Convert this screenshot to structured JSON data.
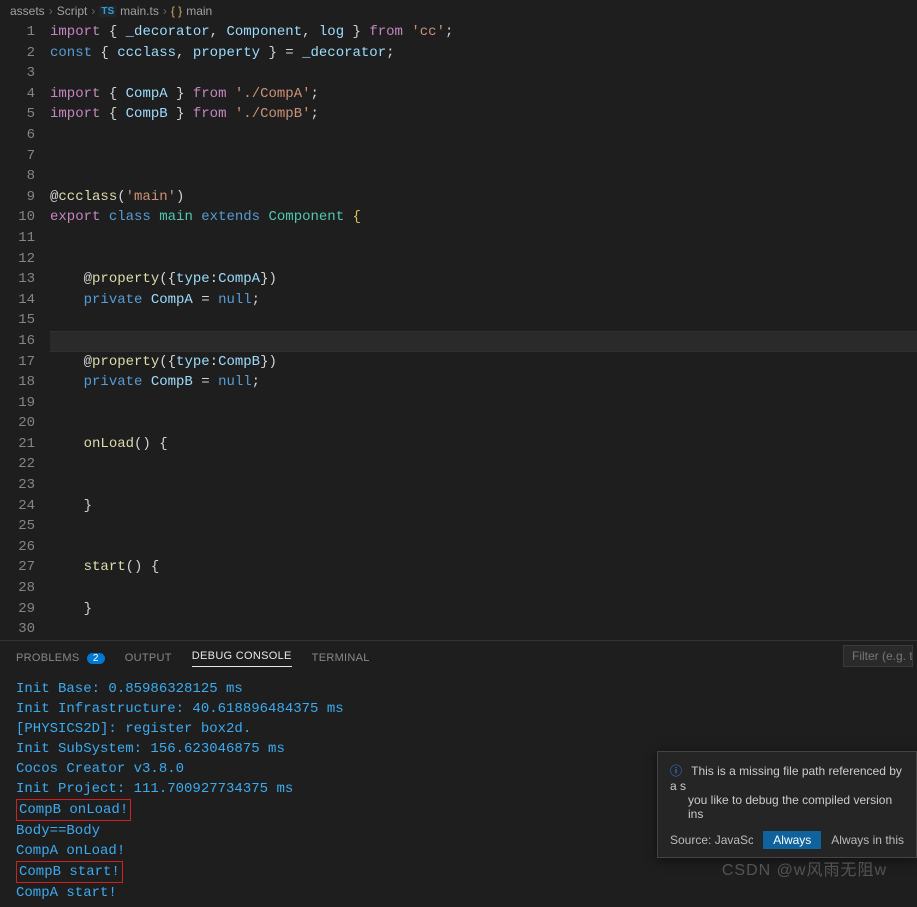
{
  "breadcrumb": {
    "parts": [
      "assets",
      "Script",
      "main.ts",
      "main"
    ],
    "file_icon": "TS",
    "symbol_icon": "braces"
  },
  "editor": {
    "current_line": 16,
    "lines": [
      {
        "n": 1,
        "t": [
          [
            "imp",
            "import"
          ],
          [
            "pun",
            " { "
          ],
          [
            "var",
            "_decorator"
          ],
          [
            "pun",
            ", "
          ],
          [
            "var",
            "Component"
          ],
          [
            "pun",
            ", "
          ],
          [
            "var",
            "log"
          ],
          [
            "pun",
            " } "
          ],
          [
            "imp",
            "from"
          ],
          [
            "pun",
            " "
          ],
          [
            "str",
            "'cc'"
          ],
          [
            "pun",
            ";"
          ]
        ]
      },
      {
        "n": 2,
        "t": [
          [
            "kw",
            "const"
          ],
          [
            "pun",
            " { "
          ],
          [
            "var",
            "ccclass"
          ],
          [
            "pun",
            ", "
          ],
          [
            "var",
            "property"
          ],
          [
            "pun",
            " } = "
          ],
          [
            "var",
            "_decorator"
          ],
          [
            "pun",
            ";"
          ]
        ]
      },
      {
        "n": 3,
        "t": []
      },
      {
        "n": 4,
        "t": [
          [
            "imp",
            "import"
          ],
          [
            "pun",
            " { "
          ],
          [
            "var",
            "CompA"
          ],
          [
            "pun",
            " } "
          ],
          [
            "imp",
            "from"
          ],
          [
            "pun",
            " "
          ],
          [
            "str",
            "'./CompA'"
          ],
          [
            "pun",
            ";"
          ]
        ]
      },
      {
        "n": 5,
        "t": [
          [
            "imp",
            "import"
          ],
          [
            "pun",
            " { "
          ],
          [
            "var",
            "CompB"
          ],
          [
            "pun",
            " } "
          ],
          [
            "imp",
            "from"
          ],
          [
            "pun",
            " "
          ],
          [
            "str",
            "'./CompB'"
          ],
          [
            "pun",
            ";"
          ]
        ]
      },
      {
        "n": 6,
        "t": []
      },
      {
        "n": 7,
        "t": []
      },
      {
        "n": 8,
        "t": []
      },
      {
        "n": 9,
        "t": [
          [
            "pun",
            "@"
          ],
          [
            "dec",
            "ccclass"
          ],
          [
            "pun",
            "("
          ],
          [
            "str",
            "'main'"
          ],
          [
            "pun",
            ")"
          ]
        ]
      },
      {
        "n": 10,
        "t": [
          [
            "imp",
            "export"
          ],
          [
            "pun",
            " "
          ],
          [
            "kw",
            "class"
          ],
          [
            "pun",
            " "
          ],
          [
            "type",
            "main"
          ],
          [
            "pun",
            " "
          ],
          [
            "kw",
            "extends"
          ],
          [
            "pun",
            " "
          ],
          [
            "type",
            "Component"
          ],
          [
            "pun",
            " "
          ],
          [
            "ybr",
            "{"
          ]
        ]
      },
      {
        "n": 11,
        "t": []
      },
      {
        "n": 12,
        "t": []
      },
      {
        "n": 13,
        "t": [
          [
            "pun",
            "    @"
          ],
          [
            "dec",
            "property"
          ],
          [
            "pun",
            "({"
          ],
          [
            "var",
            "type"
          ],
          [
            "pun",
            ":"
          ],
          [
            "var",
            "CompA"
          ],
          [
            "pun",
            "})"
          ]
        ]
      },
      {
        "n": 14,
        "t": [
          [
            "pun",
            "    "
          ],
          [
            "kw",
            "private"
          ],
          [
            "pun",
            " "
          ],
          [
            "var",
            "CompA"
          ],
          [
            "pun",
            " = "
          ],
          [
            "kw",
            "null"
          ],
          [
            "pun",
            ";"
          ]
        ]
      },
      {
        "n": 15,
        "t": []
      },
      {
        "n": 16,
        "t": []
      },
      {
        "n": 17,
        "t": [
          [
            "pun",
            "    @"
          ],
          [
            "dec",
            "property"
          ],
          [
            "pun",
            "({"
          ],
          [
            "var",
            "type"
          ],
          [
            "pun",
            ":"
          ],
          [
            "var",
            "CompB"
          ],
          [
            "pun",
            "})"
          ]
        ]
      },
      {
        "n": 18,
        "t": [
          [
            "pun",
            "    "
          ],
          [
            "kw",
            "private"
          ],
          [
            "pun",
            " "
          ],
          [
            "var",
            "CompB"
          ],
          [
            "pun",
            " = "
          ],
          [
            "kw",
            "null"
          ],
          [
            "pun",
            ";"
          ]
        ]
      },
      {
        "n": 19,
        "t": []
      },
      {
        "n": 20,
        "t": []
      },
      {
        "n": 21,
        "t": [
          [
            "pun",
            "    "
          ],
          [
            "fn",
            "onLoad"
          ],
          [
            "pun",
            "() {"
          ]
        ]
      },
      {
        "n": 22,
        "t": []
      },
      {
        "n": 23,
        "t": []
      },
      {
        "n": 24,
        "t": [
          [
            "pun",
            "    }"
          ]
        ]
      },
      {
        "n": 25,
        "t": []
      },
      {
        "n": 26,
        "t": []
      },
      {
        "n": 27,
        "t": [
          [
            "pun",
            "    "
          ],
          [
            "fn",
            "start"
          ],
          [
            "pun",
            "() {"
          ]
        ]
      },
      {
        "n": 28,
        "t": []
      },
      {
        "n": 29,
        "t": [
          [
            "pun",
            "    }"
          ]
        ]
      },
      {
        "n": 30,
        "t": []
      }
    ]
  },
  "panel": {
    "tabs": {
      "problems": "PROBLEMS",
      "problems_badge": "2",
      "output": "OUTPUT",
      "debug_console": "DEBUG CONSOLE",
      "terminal": "TERMINAL"
    },
    "active_tab": "debug_console",
    "filter_placeholder": "Filter (e.g. text"
  },
  "console_lines": [
    {
      "text": "Init Base: 0.85986328125 ms",
      "box": false
    },
    {
      "text": "Init Infrastructure: 40.618896484375 ms",
      "box": false
    },
    {
      "text": "[PHYSICS2D]: register box2d.",
      "box": false
    },
    {
      "text": "Init SubSystem: 156.623046875 ms",
      "box": false
    },
    {
      "text": "Cocos Creator v3.8.0",
      "box": false
    },
    {
      "text": "Init Project: 111.700927734375 ms",
      "box": false
    },
    {
      "text": "CompB onLoad!",
      "box": true
    },
    {
      "text": "Body==Body",
      "box": false
    },
    {
      "text": "CompA onLoad!",
      "box": false
    },
    {
      "text": "CompB start!",
      "box": true
    },
    {
      "text": "CompA start!",
      "box": false
    }
  ],
  "notification": {
    "message_l1": "This is a missing file path referenced by a s",
    "message_l2": "you like to debug the compiled version ins",
    "source": "Source: JavaScript...",
    "btn_always": "Always",
    "lnk_always_in_this": "Always in this"
  },
  "watermark": "CSDN @w风雨无阻w"
}
